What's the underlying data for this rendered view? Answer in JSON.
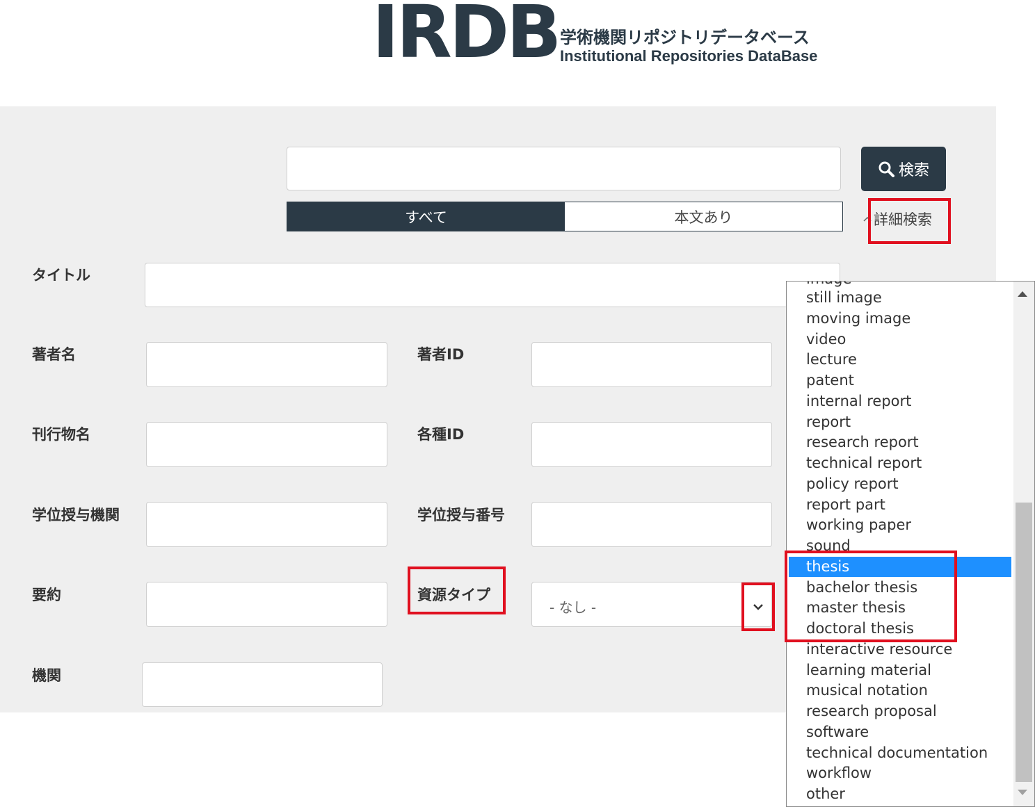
{
  "logo": {
    "mark": "IRDB",
    "jp": "学術機関リポジトリデータベース",
    "en": "Institutional Repositories DataBase"
  },
  "search": {
    "button_label": "検索",
    "scope_all": "すべて",
    "scope_fulltext": "本文あり",
    "advanced_label": "詳細検索"
  },
  "form": {
    "title": "タイトル",
    "author_name": "著者名",
    "author_id": "著者ID",
    "publication": "刊行物名",
    "various_id": "各種ID",
    "degree_grantor": "学位授与機関",
    "degree_number": "学位授与番号",
    "abstract": "要約",
    "resource_type": "資源タイプ",
    "resource_type_value": "- なし -",
    "institution": "機関"
  },
  "dropdown": {
    "partial_top": "image",
    "items": [
      "still image",
      "moving image",
      "video",
      "lecture",
      "patent",
      "internal report",
      "report",
      "research report",
      "technical report",
      "policy report",
      "report part",
      "working paper",
      "sound",
      "thesis",
      "bachelor thesis",
      "master thesis",
      "doctoral thesis",
      "interactive resource",
      "learning material",
      "musical notation",
      "research proposal",
      "software",
      "technical documentation",
      "workflow",
      "other"
    ],
    "selected": "thesis"
  },
  "colors": {
    "dark": "#2b3a46",
    "highlight": "#e0101f",
    "selection": "#1e90ff"
  }
}
